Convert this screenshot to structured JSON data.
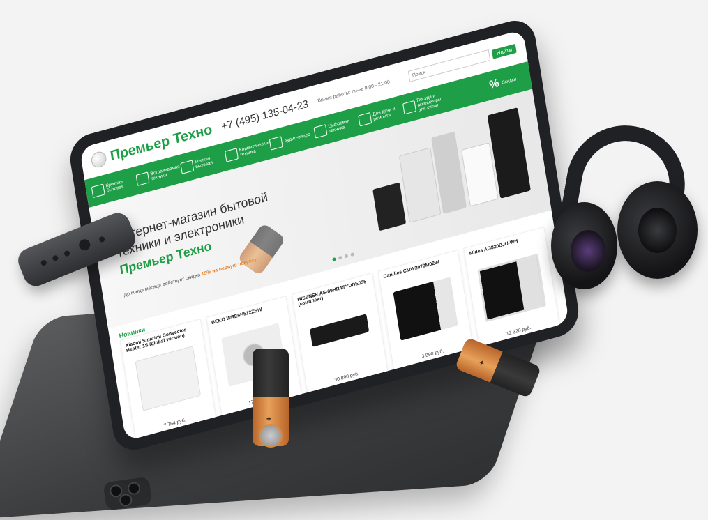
{
  "site": {
    "logo": "Премьер Техно",
    "phone": "+7 (495) 135-04-23",
    "hours": "Время работы: пн-вс 9:00 - 21:00",
    "search_placeholder": "Поиск",
    "search_button": "Найти"
  },
  "categories": [
    {
      "label": "Крупная бытовая",
      "icon": "fridge-icon"
    },
    {
      "label": "Встраиваемая техника",
      "icon": "oven-icon"
    },
    {
      "label": "Мелкая бытовая",
      "icon": "kettle-icon"
    },
    {
      "label": "Климатическая техника",
      "icon": "ac-icon"
    },
    {
      "label": "Аудио-видео",
      "icon": "tv-icon"
    },
    {
      "label": "Цифровая техника",
      "icon": "laptop-icon"
    },
    {
      "label": "Для дачи и ремонта",
      "icon": "drill-icon"
    },
    {
      "label": "Посуда и аксессуары для кухни",
      "icon": "pot-icon"
    }
  ],
  "discount_label": "Скидки",
  "discount_symbol": "%",
  "hero": {
    "title": "Интернет-магазин бытовой техники и электроники",
    "brand": "Премьер Техно",
    "promo_prefix": "До конца месяца действует скидка",
    "promo_highlight": "15% на первую покупку"
  },
  "section_title": "Новинки",
  "products": [
    {
      "name": "Xiaomi Smartmi Convector Heater 1S (global version)",
      "price": "7 764 руб.",
      "color": "#f2f2f2"
    },
    {
      "name": "BEKO WRE6H512ZSW",
      "price": "17 990 руб.",
      "color": "#e9e9e9"
    },
    {
      "name": "HISENSE AS-09HR4SYDDE035 (комплект)",
      "price": "30 890 руб.",
      "color": "#1a1a1a"
    },
    {
      "name": "Candies CMW2070M02W",
      "price": "3 890 руб.",
      "color": "#dcdcdc"
    },
    {
      "name": "Midea AG820BJU-WH",
      "price": "12 320 руб.",
      "color": "#d6d6d6"
    }
  ]
}
